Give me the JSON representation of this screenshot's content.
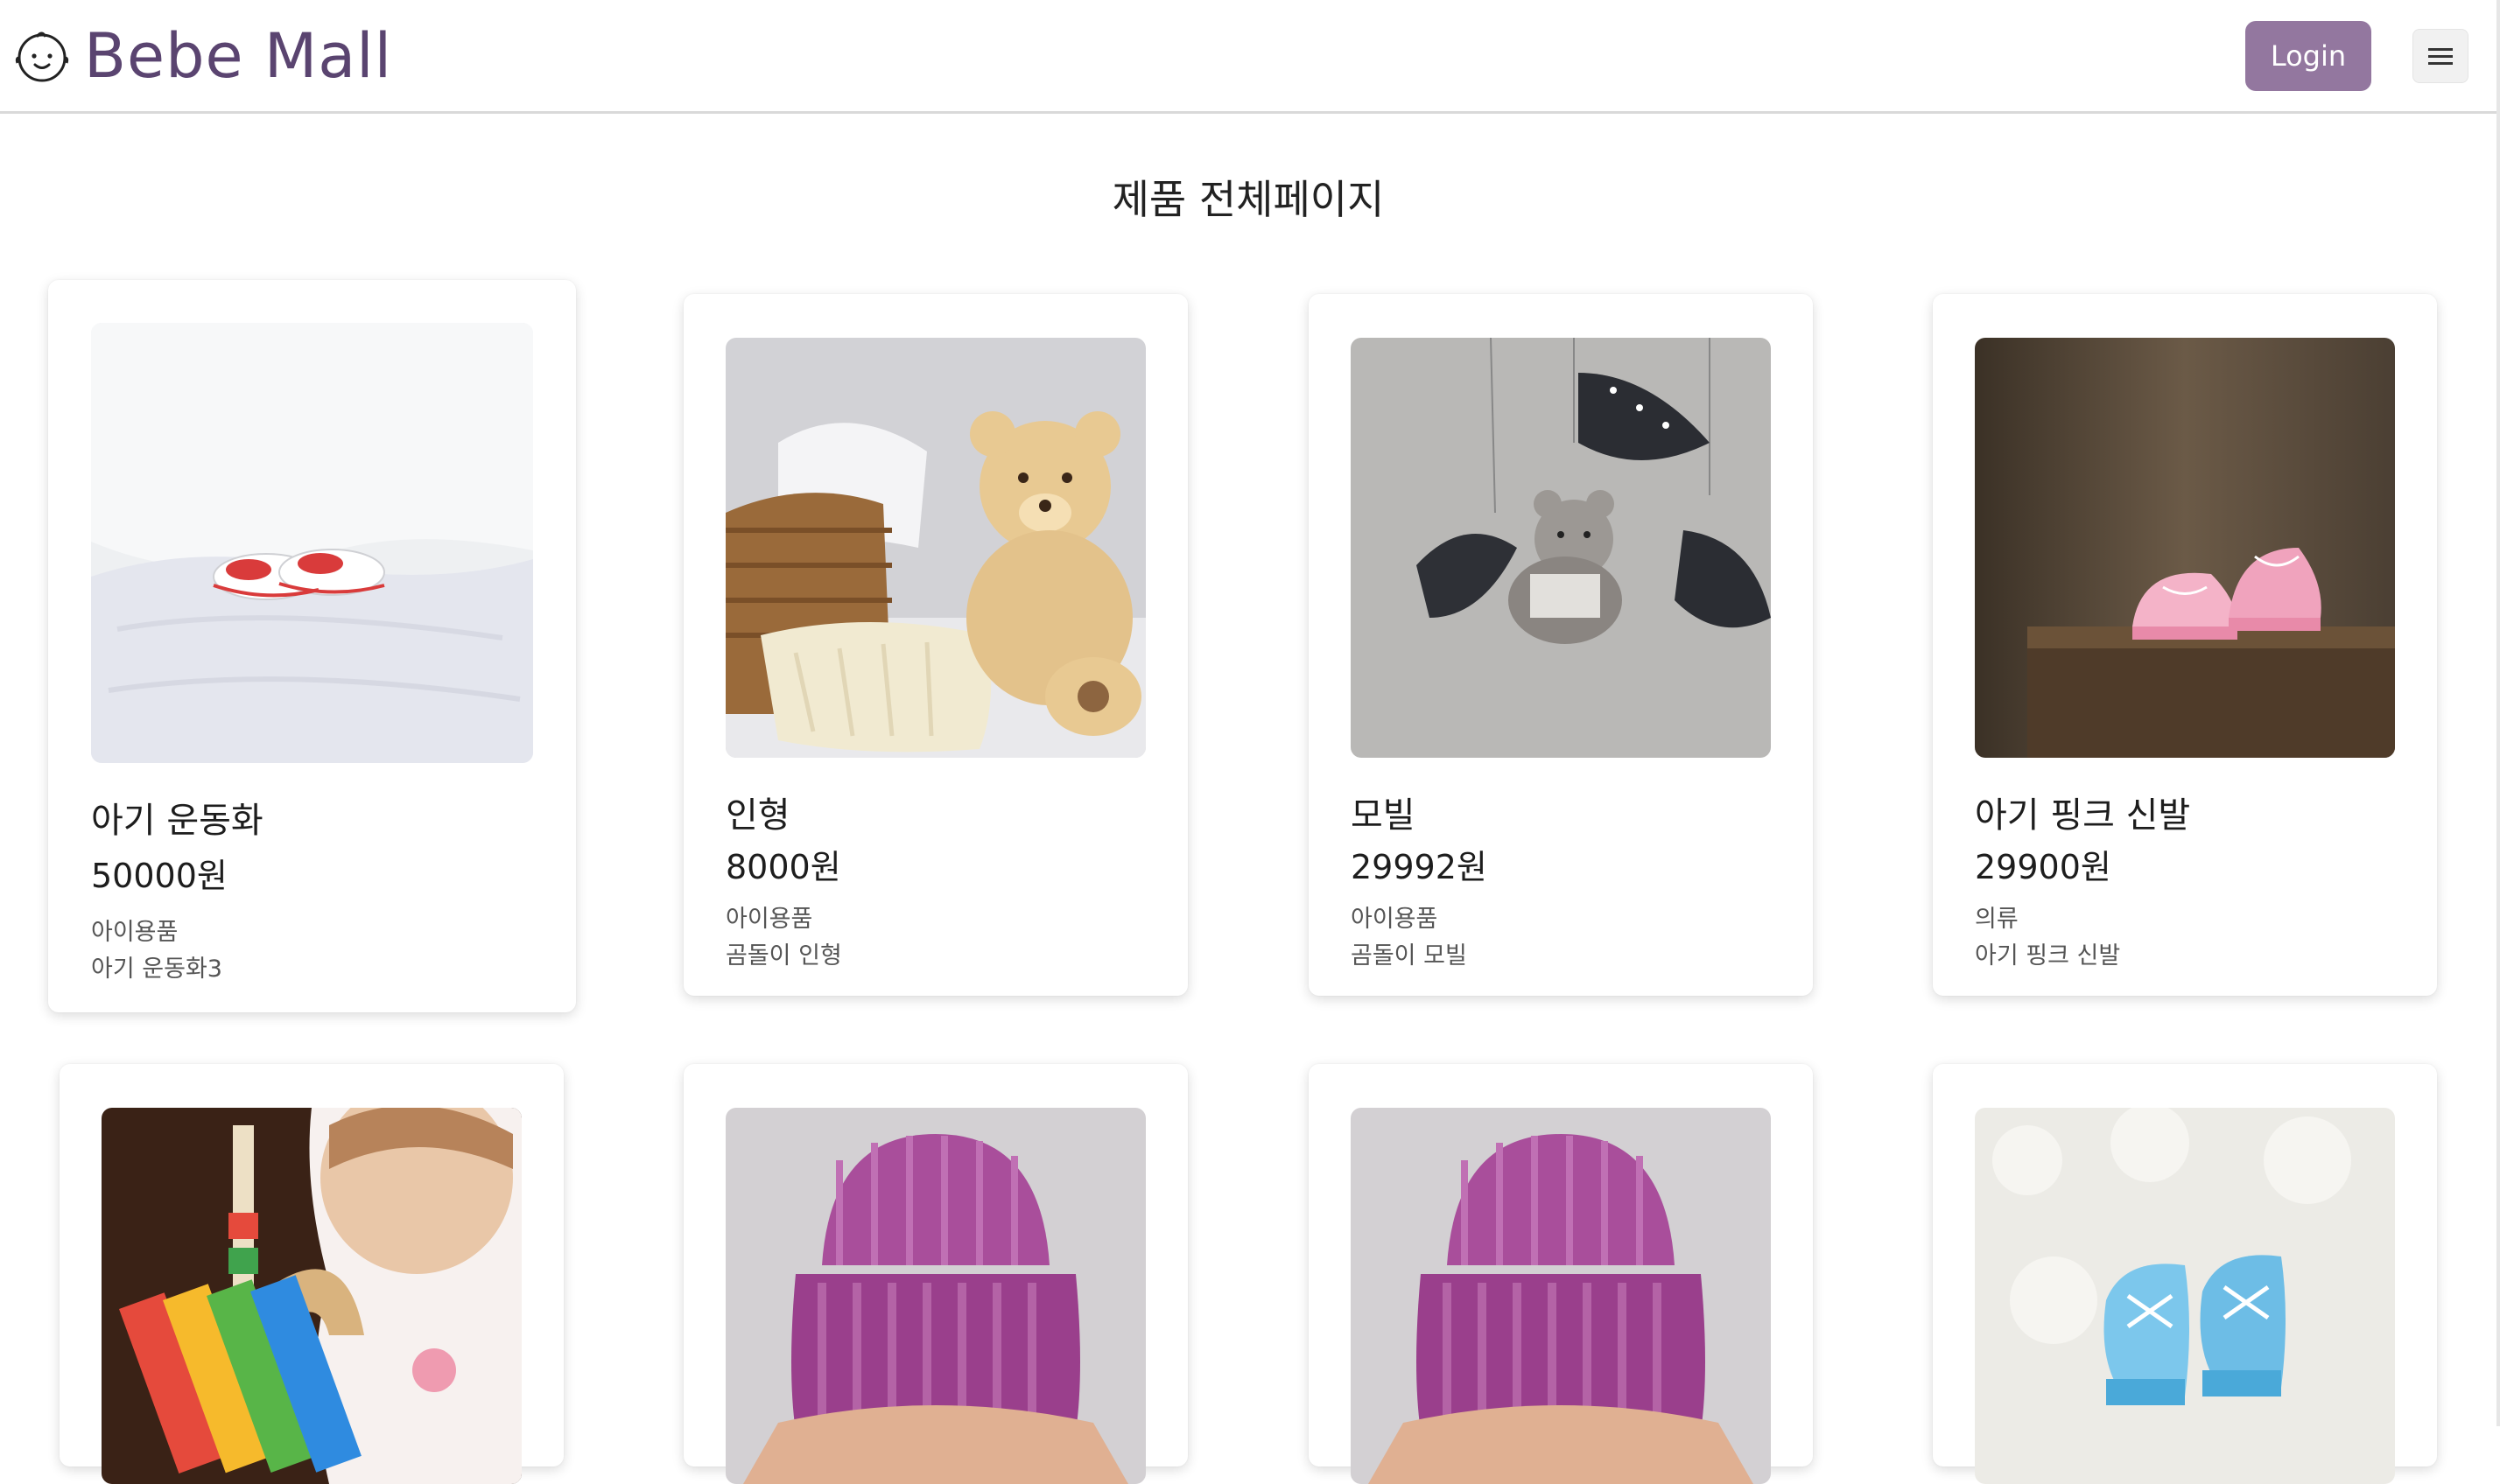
{
  "header": {
    "brand_name": "Bebe Mall",
    "login_label": "Login",
    "accent_color": "#93779f",
    "brand_color": "#5a4470"
  },
  "page_title": "제품 전체페이지",
  "products": [
    {
      "name": "아기 운동화",
      "price": "50000원",
      "category": "아이용품",
      "description": "아기 운동화3",
      "image": "white-baby-sneakers-photo"
    },
    {
      "name": "인형",
      "price": "8000원",
      "category": "아이용품",
      "description": "곰돌이 인형",
      "image": "teddy-bear-basket-photo"
    },
    {
      "name": "모빌",
      "price": "29992원",
      "category": "아이용품",
      "description": "곰돌이 모빌",
      "image": "bear-mobile-photo"
    },
    {
      "name": "아기 핑크 신발",
      "price": "29900원",
      "category": "의류",
      "description": "아기 핑크 신발",
      "image": "pink-baby-shoes-photo"
    },
    {
      "image": "baby-xylophone-photo"
    },
    {
      "image": "pink-knit-hat-photo"
    },
    {
      "image": "pink-knit-hat-photo"
    },
    {
      "image": "blue-baby-shoes-photo"
    }
  ]
}
